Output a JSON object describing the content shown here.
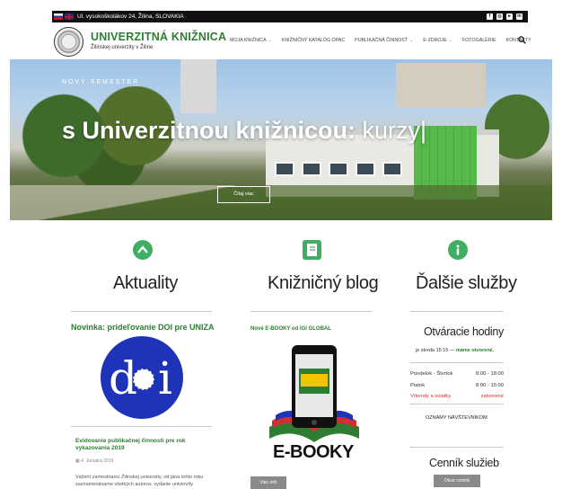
{
  "topbar": {
    "address": "Ul. vysokoškolákov 24, Žilina, SLOVAKIA",
    "flags": [
      "flag-sk",
      "flag-gb"
    ],
    "social_icons": [
      "facebook-icon",
      "instagram-icon",
      "youtube-icon",
      "linkedin-icon"
    ]
  },
  "brand": {
    "title": "UNIVERZITNÁ KNIŽNICA",
    "subtitle": "Žilinskej univerzity v Žiline"
  },
  "nav": {
    "items": [
      {
        "label": "MOJA KNIŽNICA",
        "has_dropdown": true
      },
      {
        "label": "KNIŽNIČNÝ KATALÓG OPAC",
        "has_dropdown": false
      },
      {
        "label": "PUBLIKAČNÁ ČINNOSŤ",
        "has_dropdown": true
      },
      {
        "label": "E-ZDROJE",
        "has_dropdown": true
      },
      {
        "label": "FOTOGALÉRIE",
        "has_dropdown": false
      },
      {
        "label": "KONTAKTY",
        "has_dropdown": false
      }
    ],
    "dropdown_glyph": "⌄"
  },
  "hero": {
    "kicker": "NOVÝ SEMESTER",
    "headline_bold": "s Univerzitnou knižnicou:",
    "headline_typed": " kurzy|",
    "cta_label": "Čítaj viac"
  },
  "columns": {
    "news": {
      "title": "Aktuality",
      "post1_title": "Novinka: prideľovanie DOI pre UNIZA",
      "post2_title": "Evidovanie publikačnej činnosti pre rok vykazovania 2019",
      "post2_date": "4. Januára 2019",
      "post2_excerpt": "Vážení zamestnanci Žilinskej univerzity, od jána tohto roku zaznamenávame všetkých autorov, vydanie univerzity"
    },
    "blog": {
      "title": "Knižničný blog",
      "post_title": "Nové E-BOOKY od IGI GLOBAL",
      "image_label": "E-BOOKY",
      "more_label": "Viac info"
    },
    "services": {
      "title": "Ďalšie služby",
      "hours_title": "Otváracie hodiny",
      "today_prefix": "je streda 15:15 — ",
      "today_status": "máme otvorené.",
      "rows": [
        {
          "day": "Pondelok - Štvrtok",
          "time": "8:00 - 18:00",
          "closed": false
        },
        {
          "day": "Piatok",
          "time": "8:00 - 15:00",
          "closed": false
        },
        {
          "day": "Víkendy a sviatky",
          "time": "zatvorené",
          "closed": true
        }
      ],
      "notices": "OZNAMY NÁVŠTEVNÍKOM",
      "price_title": "Cenník služieb",
      "price_button": "Otvor cenník"
    }
  },
  "colors": {
    "accent_green": "#3fae63",
    "title_green": "#2e7d32",
    "closed_red": "#d32f2f",
    "button_grey": "#8a8a8a"
  }
}
